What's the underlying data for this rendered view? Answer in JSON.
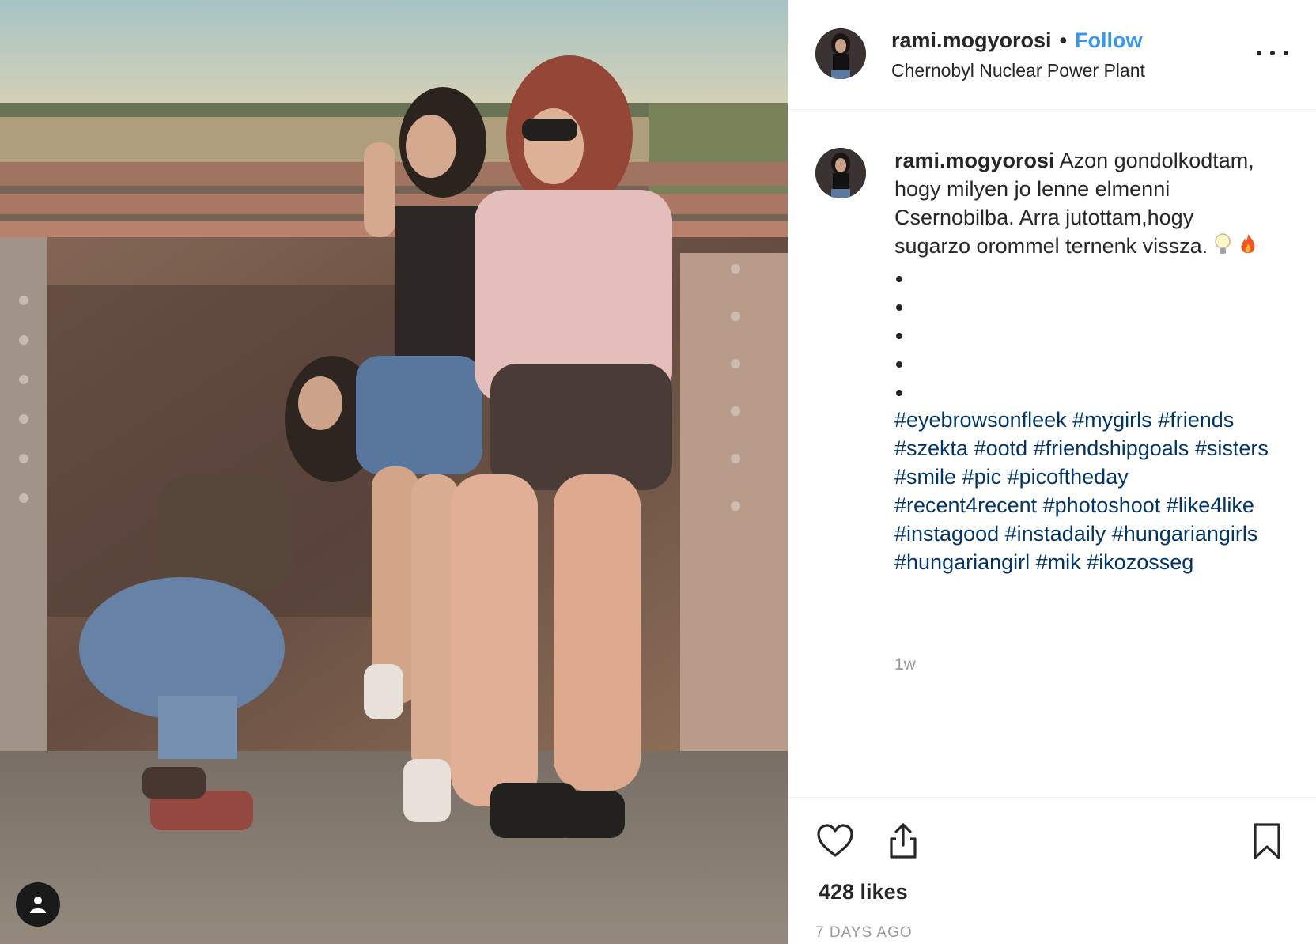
{
  "post": {
    "photo_description_label": "",
    "owner": {
      "username": "rami.mogyorosi",
      "follow_label": "Follow",
      "location": "Chernobyl Nuclear Power Plant",
      "avatar_icon": "profile-photo"
    },
    "caption": {
      "username": "rami.mogyorosi",
      "text": "Azon gondolkodtam, hogy milyen jo lenne elmenni Csernobilba. Arra jutottam,hogy sugarzo orommel ternenk vissza.",
      "emojis": [
        "lightbulb-icon",
        "fire-icon"
      ],
      "bullet_count": 5,
      "hashtags": [
        "#eyebrowsonfleek",
        "#mygirls",
        "#friends",
        "#szekta",
        "#ootd",
        "#friendshipgoals",
        "#sisters",
        "#smile",
        "#pic",
        "#picoftheday",
        "#recent4recent",
        "#photoshoot",
        "#like4like",
        "#instagood",
        "#instadaily",
        "#hungariangirls",
        "#hungariangirl",
        "#mik",
        "#ikozosseg"
      ],
      "time_short": "1w"
    },
    "actions": {
      "icons": [
        "heart-icon",
        "share-icon",
        "bookmark-icon"
      ]
    },
    "likes_text": "428 likes",
    "date_text": "7 DAYS AGO"
  },
  "colors": {
    "link_blue": "#3897f0",
    "hashtag_blue": "#003569",
    "muted_gray": "#999999",
    "text": "#262626",
    "border": "#efefef"
  }
}
